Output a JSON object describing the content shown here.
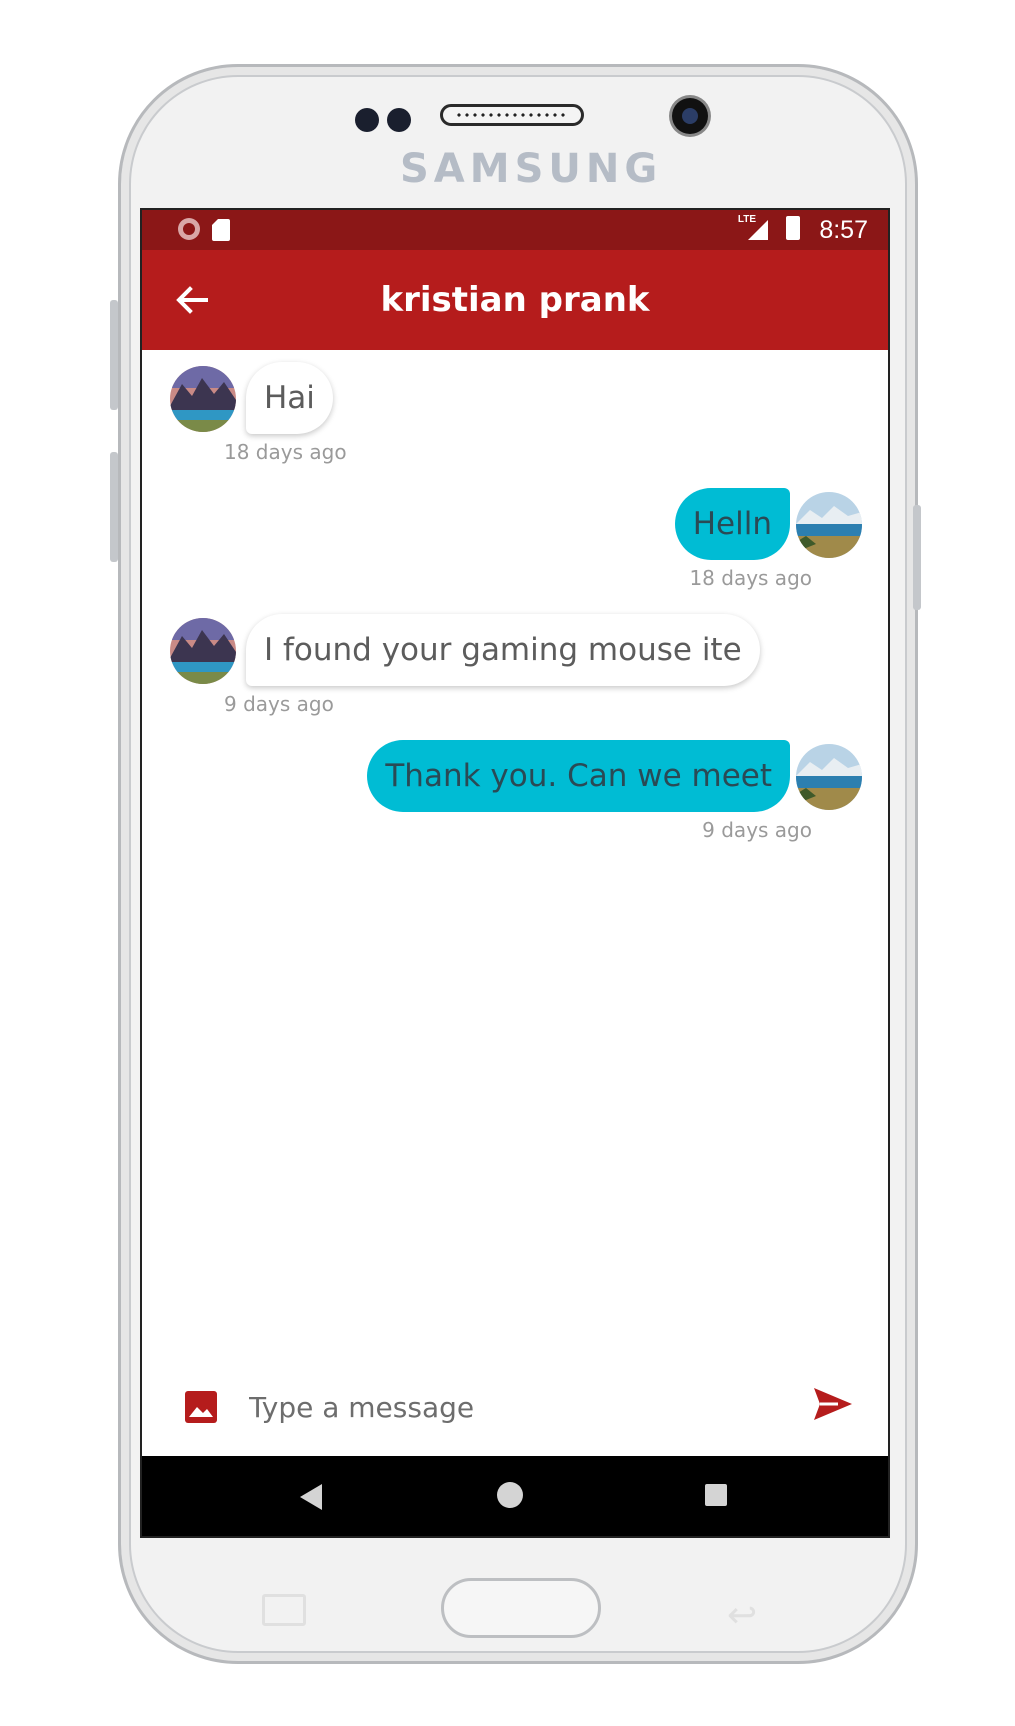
{
  "device": {
    "brand": "SAMSUNG"
  },
  "status_bar": {
    "time": "8:57",
    "network": "LTE"
  },
  "app_bar": {
    "title": "kristian prank"
  },
  "messages": [
    {
      "direction": "incoming",
      "text": "Hai",
      "time": "18 days ago"
    },
    {
      "direction": "outgoing",
      "text": "Helln",
      "time": "18 days ago"
    },
    {
      "direction": "incoming",
      "text": "I found your gaming mouse ite",
      "time": "9 days ago"
    },
    {
      "direction": "outgoing",
      "text": "Thank you. Can we meet",
      "time": "9 days ago"
    }
  ],
  "composer": {
    "placeholder": "Type a message"
  },
  "icons": {
    "back": "arrow-left-icon",
    "attach": "image-icon",
    "send": "send-icon"
  },
  "colors": {
    "app_bar": "#b51c1c",
    "status_bar": "#8b1717",
    "outgoing_bubble": "#00bcd4",
    "incoming_bubble": "#ffffff",
    "accent": "#b51c1c"
  }
}
